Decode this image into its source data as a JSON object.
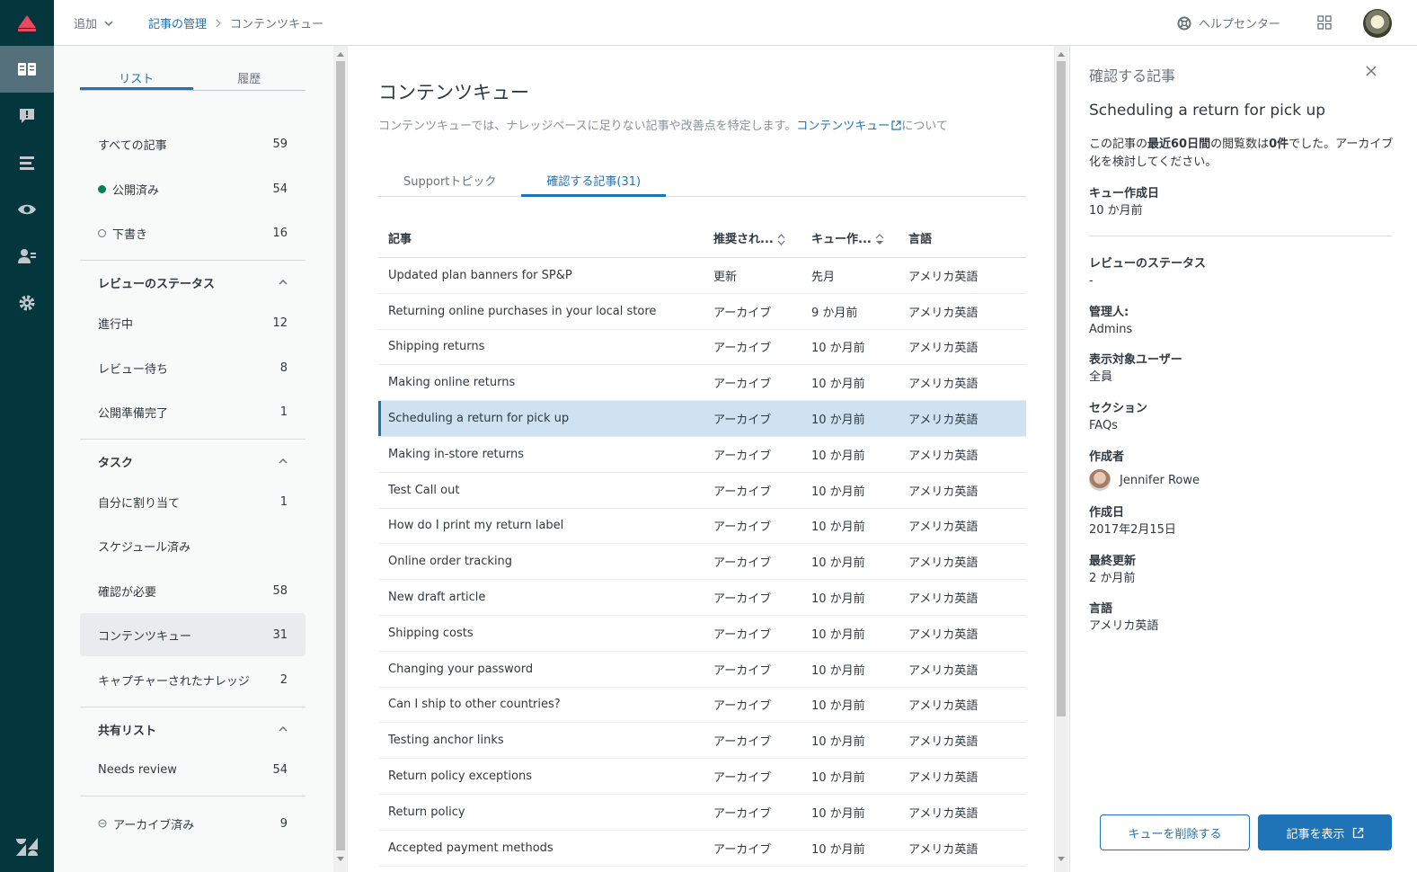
{
  "topbar": {
    "add_label": "追加",
    "breadcrumb_parent": "記事の管理",
    "breadcrumb_current": "コンテンツキュー",
    "help_center_label": "ヘルプセンター"
  },
  "sidebar": {
    "tabs": [
      "リスト",
      "履歴"
    ],
    "all_articles": {
      "label": "すべての記事",
      "count": "59"
    },
    "published": {
      "label": "公開済み",
      "count": "54"
    },
    "drafts": {
      "label": "下書き",
      "count": "16"
    },
    "review_status": {
      "heading": "レビューのステータス",
      "items": [
        {
          "label": "進行中",
          "count": "12"
        },
        {
          "label": "レビュー待ち",
          "count": "8"
        },
        {
          "label": "公開準備完了",
          "count": "1"
        }
      ]
    },
    "tasks": {
      "heading": "タスク",
      "items": [
        {
          "label": "自分に割り当て",
          "count": "1"
        },
        {
          "label": "スケジュール済み",
          "count": ""
        },
        {
          "label": "確認が必要",
          "count": "58"
        },
        {
          "label": "コンテンツキュー",
          "count": "31"
        },
        {
          "label": "キャプチャーされたナレッジ",
          "count": "2"
        }
      ]
    },
    "shared_lists": {
      "heading": "共有リスト",
      "items": [
        {
          "label": "Needs review",
          "count": "54"
        }
      ]
    },
    "archived": {
      "label": "アーカイブ済み",
      "count": "9"
    }
  },
  "main": {
    "title": "コンテンツキュー",
    "description_before": "コンテンツキューでは、ナレッジベースに足りない記事や改善点を特定します。",
    "description_link": "コンテンツキュー",
    "description_after": "について",
    "tabs": [
      "Supportトピック",
      "確認する記事(31)"
    ],
    "table": {
      "headers": [
        "記事",
        "推奨され...",
        "キュー作...",
        "言語"
      ],
      "rows": [
        [
          "Updated plan banners for SP&P",
          "更新",
          "先月",
          "アメリカ英語"
        ],
        [
          "Returning online purchases in your local store",
          "アーカイブ",
          "9 か月前",
          "アメリカ英語"
        ],
        [
          "Shipping returns",
          "アーカイブ",
          "10 か月前",
          "アメリカ英語"
        ],
        [
          "Making online returns",
          "アーカイブ",
          "10 か月前",
          "アメリカ英語"
        ],
        [
          "Scheduling a return for pick up",
          "アーカイブ",
          "10 か月前",
          "アメリカ英語"
        ],
        [
          "Making in-store returns",
          "アーカイブ",
          "10 か月前",
          "アメリカ英語"
        ],
        [
          "Test Call out",
          "アーカイブ",
          "10 か月前",
          "アメリカ英語"
        ],
        [
          "How do I print my return label",
          "アーカイブ",
          "10 か月前",
          "アメリカ英語"
        ],
        [
          "Online order tracking",
          "アーカイブ",
          "10 か月前",
          "アメリカ英語"
        ],
        [
          "New draft article",
          "アーカイブ",
          "10 か月前",
          "アメリカ英語"
        ],
        [
          "Shipping costs",
          "アーカイブ",
          "10 か月前",
          "アメリカ英語"
        ],
        [
          "Changing your password",
          "アーカイブ",
          "10 か月前",
          "アメリカ英語"
        ],
        [
          "Can I ship to other countries?",
          "アーカイブ",
          "10 か月前",
          "アメリカ英語"
        ],
        [
          "Testing anchor links",
          "アーカイブ",
          "10 か月前",
          "アメリカ英語"
        ],
        [
          "Return policy exceptions",
          "アーカイブ",
          "10 か月前",
          "アメリカ英語"
        ],
        [
          "Return policy",
          "アーカイブ",
          "10 か月前",
          "アメリカ英語"
        ],
        [
          "Accepted payment methods",
          "アーカイブ",
          "10 か月前",
          "アメリカ英語"
        ]
      ]
    }
  },
  "detail": {
    "panel_title": "確認する記事",
    "article_title": "Scheduling a return for pick up",
    "message_1": "この記事の",
    "message_bold_1": "最近60日間",
    "message_2": "の閲覧数は",
    "message_bold_2": "0件",
    "message_3": "でした。アーカイブ化を検討してください。",
    "queue_created_label": "キュー作成日",
    "queue_created_value": "10 か月前",
    "review_status_label": "レビューのステータス",
    "review_status_value": "-",
    "manager_label": "管理人:",
    "manager_value": "Admins",
    "visible_to_label": "表示対象ユーザー",
    "visible_to_value": "全員",
    "section_label": "セクション",
    "section_value": "FAQs",
    "author_label": "作成者",
    "author_value": "Jennifer Rowe",
    "created_label": "作成日",
    "created_value": "2017年2月15日",
    "updated_label": "最終更新",
    "updated_value": "2 か月前",
    "language_label": "言語",
    "language_value": "アメリカ英語",
    "remove_button": "キューを削除する",
    "view_button": "記事を表示"
  },
  "colors": {
    "rail": "#03363d",
    "accent": "#1f73b7",
    "selected_row": "#cee2f2",
    "published_dot": "#038153"
  }
}
